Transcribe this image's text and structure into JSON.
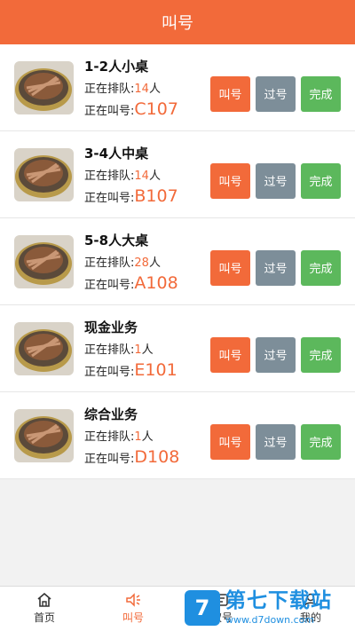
{
  "header": {
    "title": "叫号"
  },
  "queues": [
    {
      "title": "1-2人小桌",
      "waiting_label": "正在排队:",
      "waiting_count": "14",
      "waiting_unit": "人",
      "calling_label": "正在叫号:",
      "calling_code": "C107"
    },
    {
      "title": "3-4人中桌",
      "waiting_label": "正在排队:",
      "waiting_count": "14",
      "waiting_unit": "人",
      "calling_label": "正在叫号:",
      "calling_code": "B107"
    },
    {
      "title": "5-8人大桌",
      "waiting_label": "正在排队:",
      "waiting_count": "28",
      "waiting_unit": "人",
      "calling_label": "正在叫号:",
      "calling_code": "A108"
    },
    {
      "title": "现金业务",
      "waiting_label": "正在排队:",
      "waiting_count": "1",
      "waiting_unit": "人",
      "calling_label": "正在叫号:",
      "calling_code": "E101"
    },
    {
      "title": "综合业务",
      "waiting_label": "正在排队:",
      "waiting_count": "1",
      "waiting_unit": "人",
      "calling_label": "正在叫号:",
      "calling_code": "D108"
    }
  ],
  "buttons": {
    "call": "叫号",
    "pass": "过号",
    "done": "完成"
  },
  "tabs": [
    {
      "label": "首页",
      "icon": "home-icon"
    },
    {
      "label": "叫号",
      "icon": "speaker-icon"
    },
    {
      "label": "取号",
      "icon": "ticket-icon"
    },
    {
      "label": "我的",
      "icon": "user-icon"
    }
  ],
  "watermark": {
    "brand": "第七下载站",
    "url": "www.d7down.com",
    "logo_letter": "7"
  },
  "colors": {
    "accent": "#f26a3a",
    "pass": "#7d8e99",
    "done": "#5cb85c"
  }
}
